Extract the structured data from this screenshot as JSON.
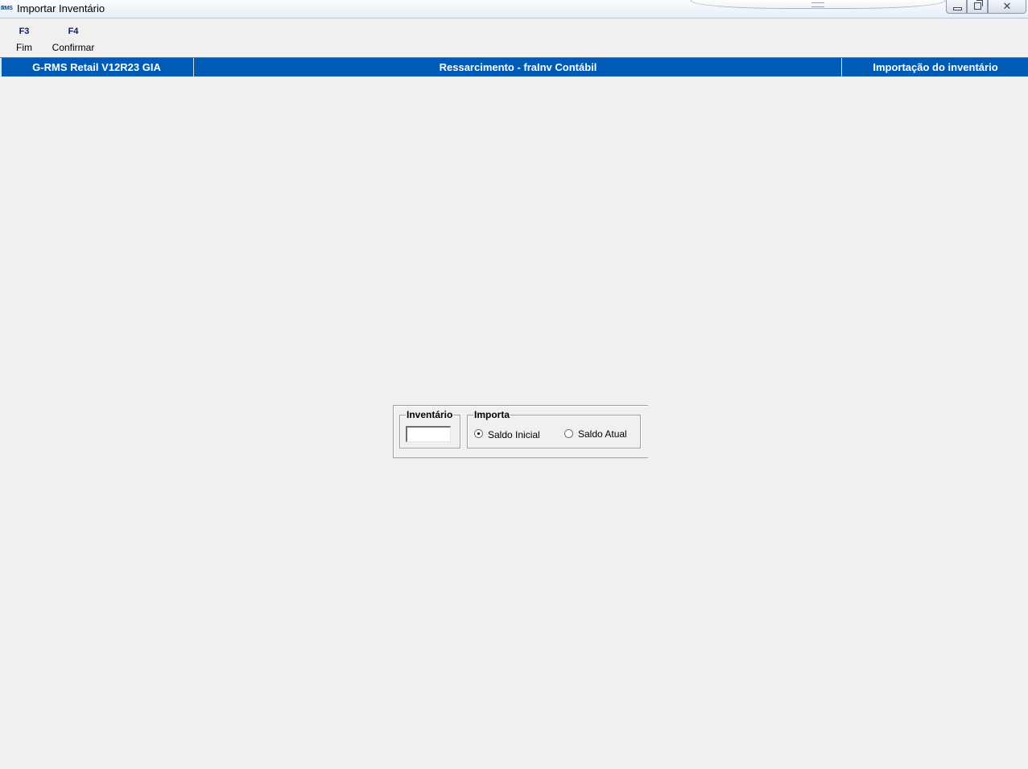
{
  "window": {
    "title": "Importar Inventário",
    "app_icon_text": "RMS",
    "close_glyph": "✕"
  },
  "toolbar": {
    "f3": {
      "key": "F3",
      "label": "Fim"
    },
    "f4": {
      "key": "F4",
      "label": "Confirmar"
    }
  },
  "header": {
    "system": "G-RMS Retail V12R23 GIA",
    "module": "Ressarcimento - fraInv Contábil",
    "screen": "Importação do inventário"
  },
  "form": {
    "inventario": {
      "legend": "Inventário",
      "value": ""
    },
    "importa": {
      "legend": "Importa",
      "options": [
        {
          "label": "Saldo Inicial",
          "selected": true
        },
        {
          "label": "Saldo Atual",
          "selected": false
        }
      ]
    }
  },
  "colors": {
    "header_band": "#005bb7",
    "background": "#f0f0f0",
    "fkey_text": "#0a1a6a"
  },
  "icons": {
    "app": "rms-app-icon",
    "minimize": "minimize-icon",
    "restore": "restore-icon",
    "close": "close-icon"
  }
}
